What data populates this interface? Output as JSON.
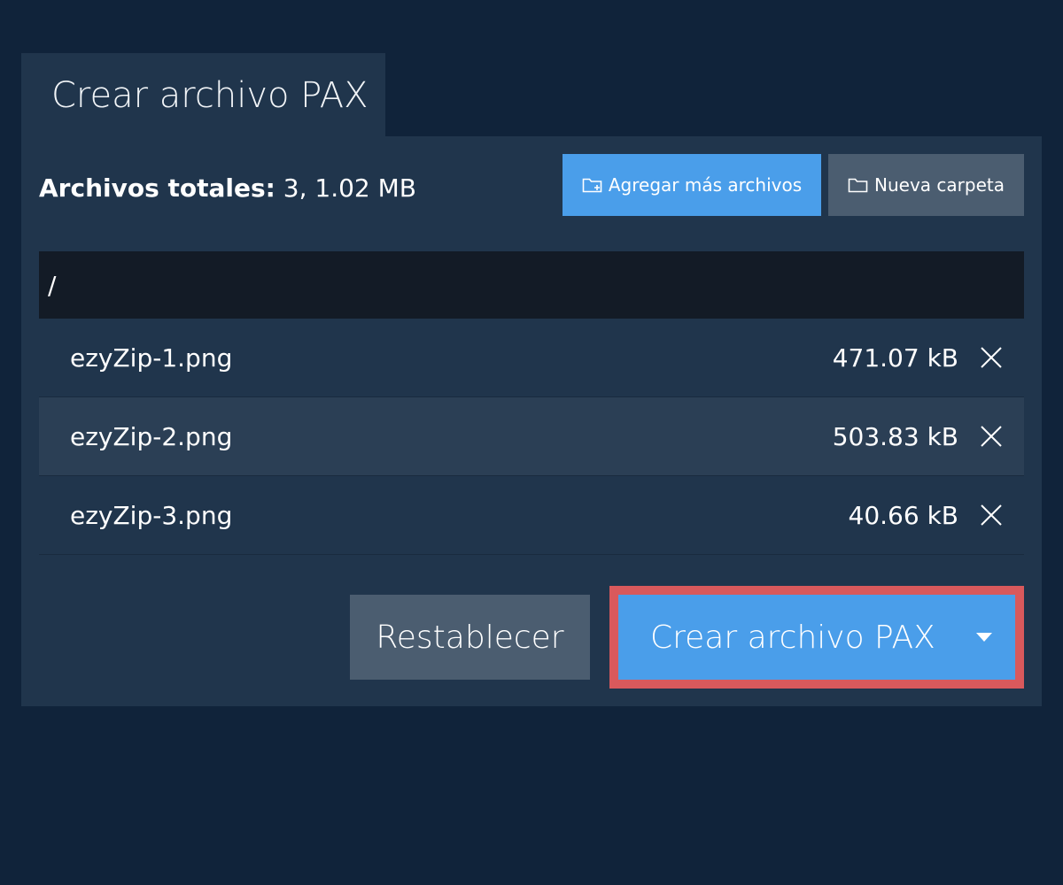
{
  "tab": {
    "title": "Crear archivo PAX"
  },
  "summary": {
    "label": "Archivos totales:",
    "value": "3, 1.02 MB"
  },
  "toolbar": {
    "add_files_label": "Agregar más archivos",
    "new_folder_label": "Nueva carpeta"
  },
  "path": {
    "current": "/"
  },
  "files": [
    {
      "name": "ezyZip-1.png",
      "size": "471.07 kB"
    },
    {
      "name": "ezyZip-2.png",
      "size": "503.83 kB"
    },
    {
      "name": "ezyZip-3.png",
      "size": "40.66 kB"
    }
  ],
  "actions": {
    "reset_label": "Restablecer",
    "create_label": "Crear archivo PAX"
  },
  "colors": {
    "background": "#10233a",
    "panel": "#20354c",
    "accent": "#4a9eea",
    "secondary": "#4b5d70",
    "highlight": "#d9595c"
  },
  "icons": {
    "add_files": "folder-plus-icon",
    "new_folder": "folder-icon",
    "remove": "close-icon",
    "dropdown": "caret-down-icon"
  }
}
